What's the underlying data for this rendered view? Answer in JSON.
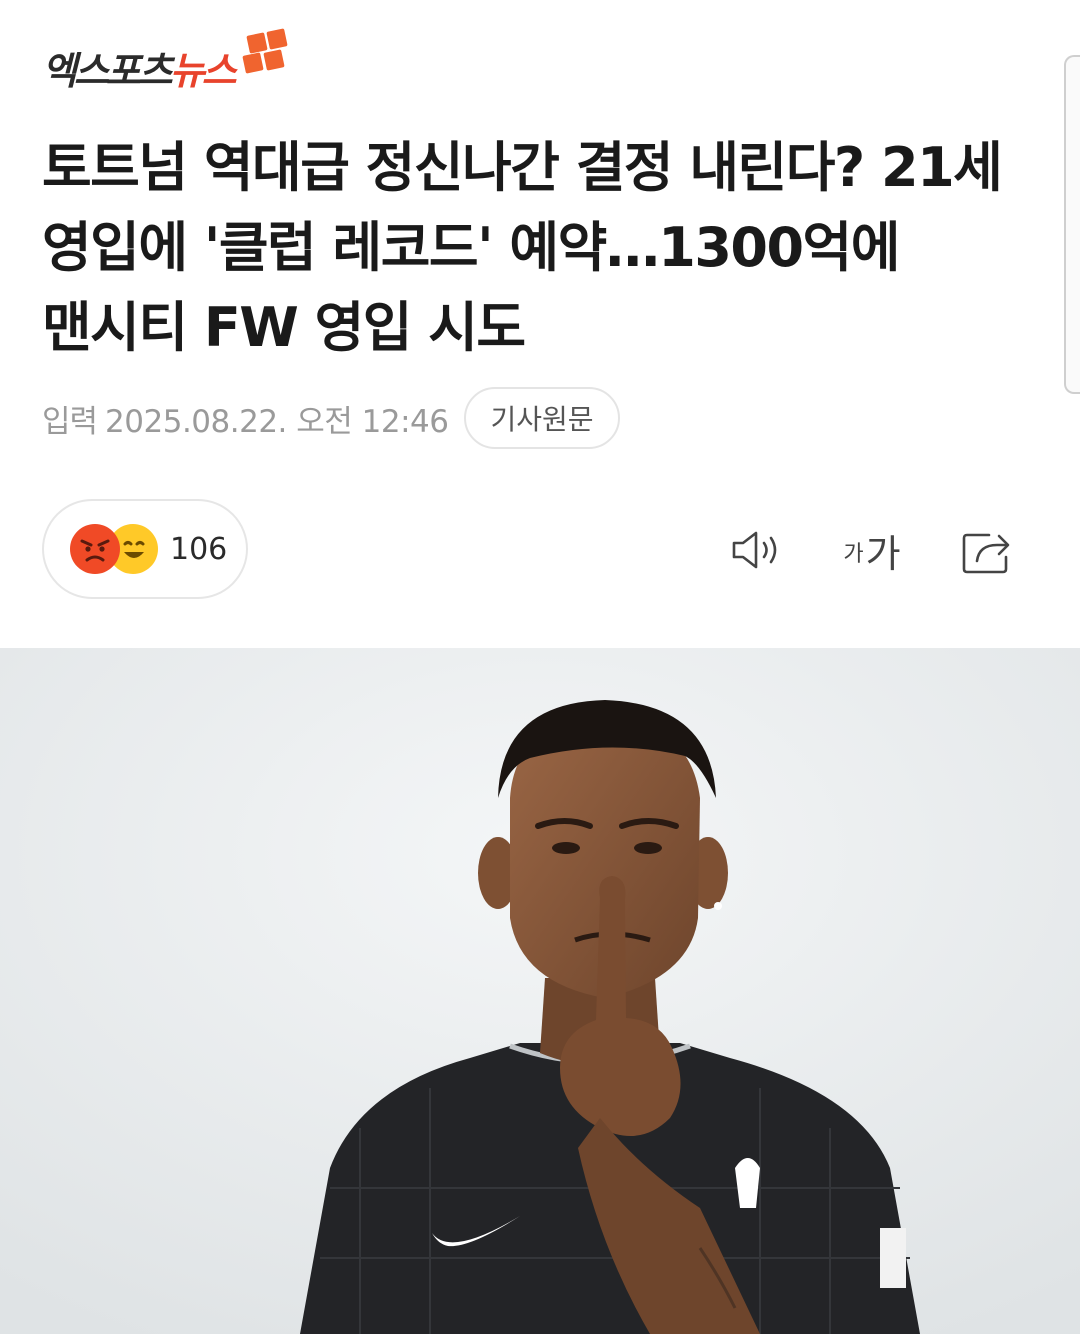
{
  "brand": {
    "name_dark": "엑스포츠",
    "name_accent": "뉴스",
    "accent_color": "#e8432c",
    "mark_color": "#f0642f"
  },
  "article": {
    "headline": "토트넘 역대급 정신나간 결정 내린다? 21세 영입에 '클럽 레코드' 예약…1300억에 맨시티 FW 영입 시도",
    "published_label": "입력",
    "published_at": "2025.08.22. 오전 12:46",
    "source_button": "기사원문"
  },
  "reactions": {
    "count": "106",
    "emojis": [
      "angry-emoji-icon",
      "happy-emoji-icon"
    ]
  },
  "toolbar": {
    "speaker_icon": "speaker-icon",
    "font_small": "가",
    "font_large": "가",
    "share_icon": "share-icon"
  },
  "photo": {
    "subject": "player-photo",
    "background_color": "#e9eced",
    "shirt_color": "#232427",
    "skin_color": "#8a5a3c"
  }
}
